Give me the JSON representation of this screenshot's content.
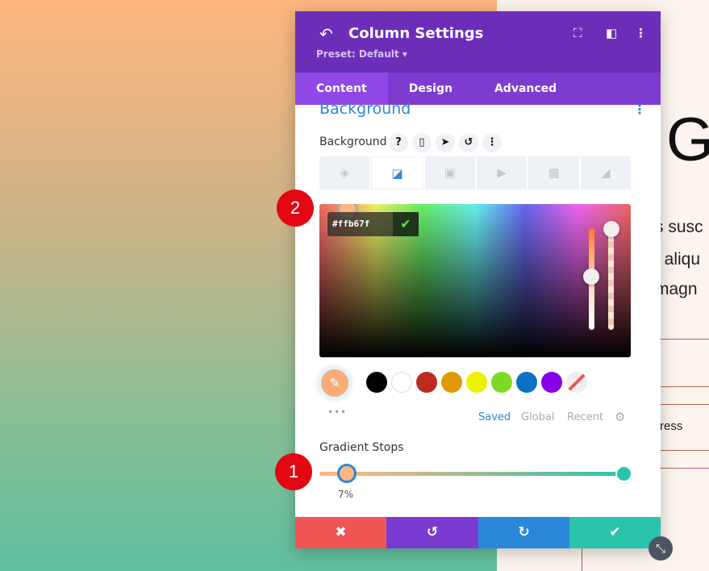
{
  "page": {
    "heading_fragment": "G",
    "text_lines": [
      "s susc",
      "t aliqu",
      "magn"
    ],
    "word_fragment": "ress"
  },
  "panel": {
    "title": "Column Settings",
    "preset": "Preset: Default ▾",
    "tabs": [
      {
        "label": "Content",
        "active": true
      },
      {
        "label": "Design"
      },
      {
        "label": "Advanced"
      }
    ],
    "section_title": "Background",
    "field_label": "Background",
    "field_icons": [
      "help-icon",
      "mobile-icon",
      "hover-cursor-icon",
      "reset-icon",
      "more-icon"
    ],
    "bg_types": [
      "color",
      "gradient",
      "image",
      "video",
      "pattern",
      "mask"
    ],
    "active_bg_type": "gradient",
    "picker": {
      "hex": "#ffb67f",
      "current_color": "#ffb67f"
    },
    "swatches": [
      "#000000",
      "#ffffff",
      "#bf2a20",
      "#e09900",
      "#edf000",
      "#7cda24",
      "#0c71c3",
      "#8300e9",
      "transparent"
    ],
    "palette_tabs": [
      "Saved",
      "Global",
      "Recent"
    ],
    "gradient": {
      "label": "Gradient Stops",
      "stops": [
        {
          "color": "#ffb67f",
          "position": "7%"
        },
        {
          "color": "#29c4a9",
          "position": "100%"
        }
      ]
    },
    "footer": [
      "cancel",
      "undo",
      "redo",
      "save"
    ]
  },
  "badges": [
    "1",
    "2"
  ],
  "colors": {
    "header": "#6c2eb9",
    "tabs": "#7e3bd0",
    "accent": "#2b87da",
    "cancel": "#ef5555",
    "undo": "#7b3bd0",
    "redo": "#2b87da",
    "save": "#29c4a9"
  }
}
